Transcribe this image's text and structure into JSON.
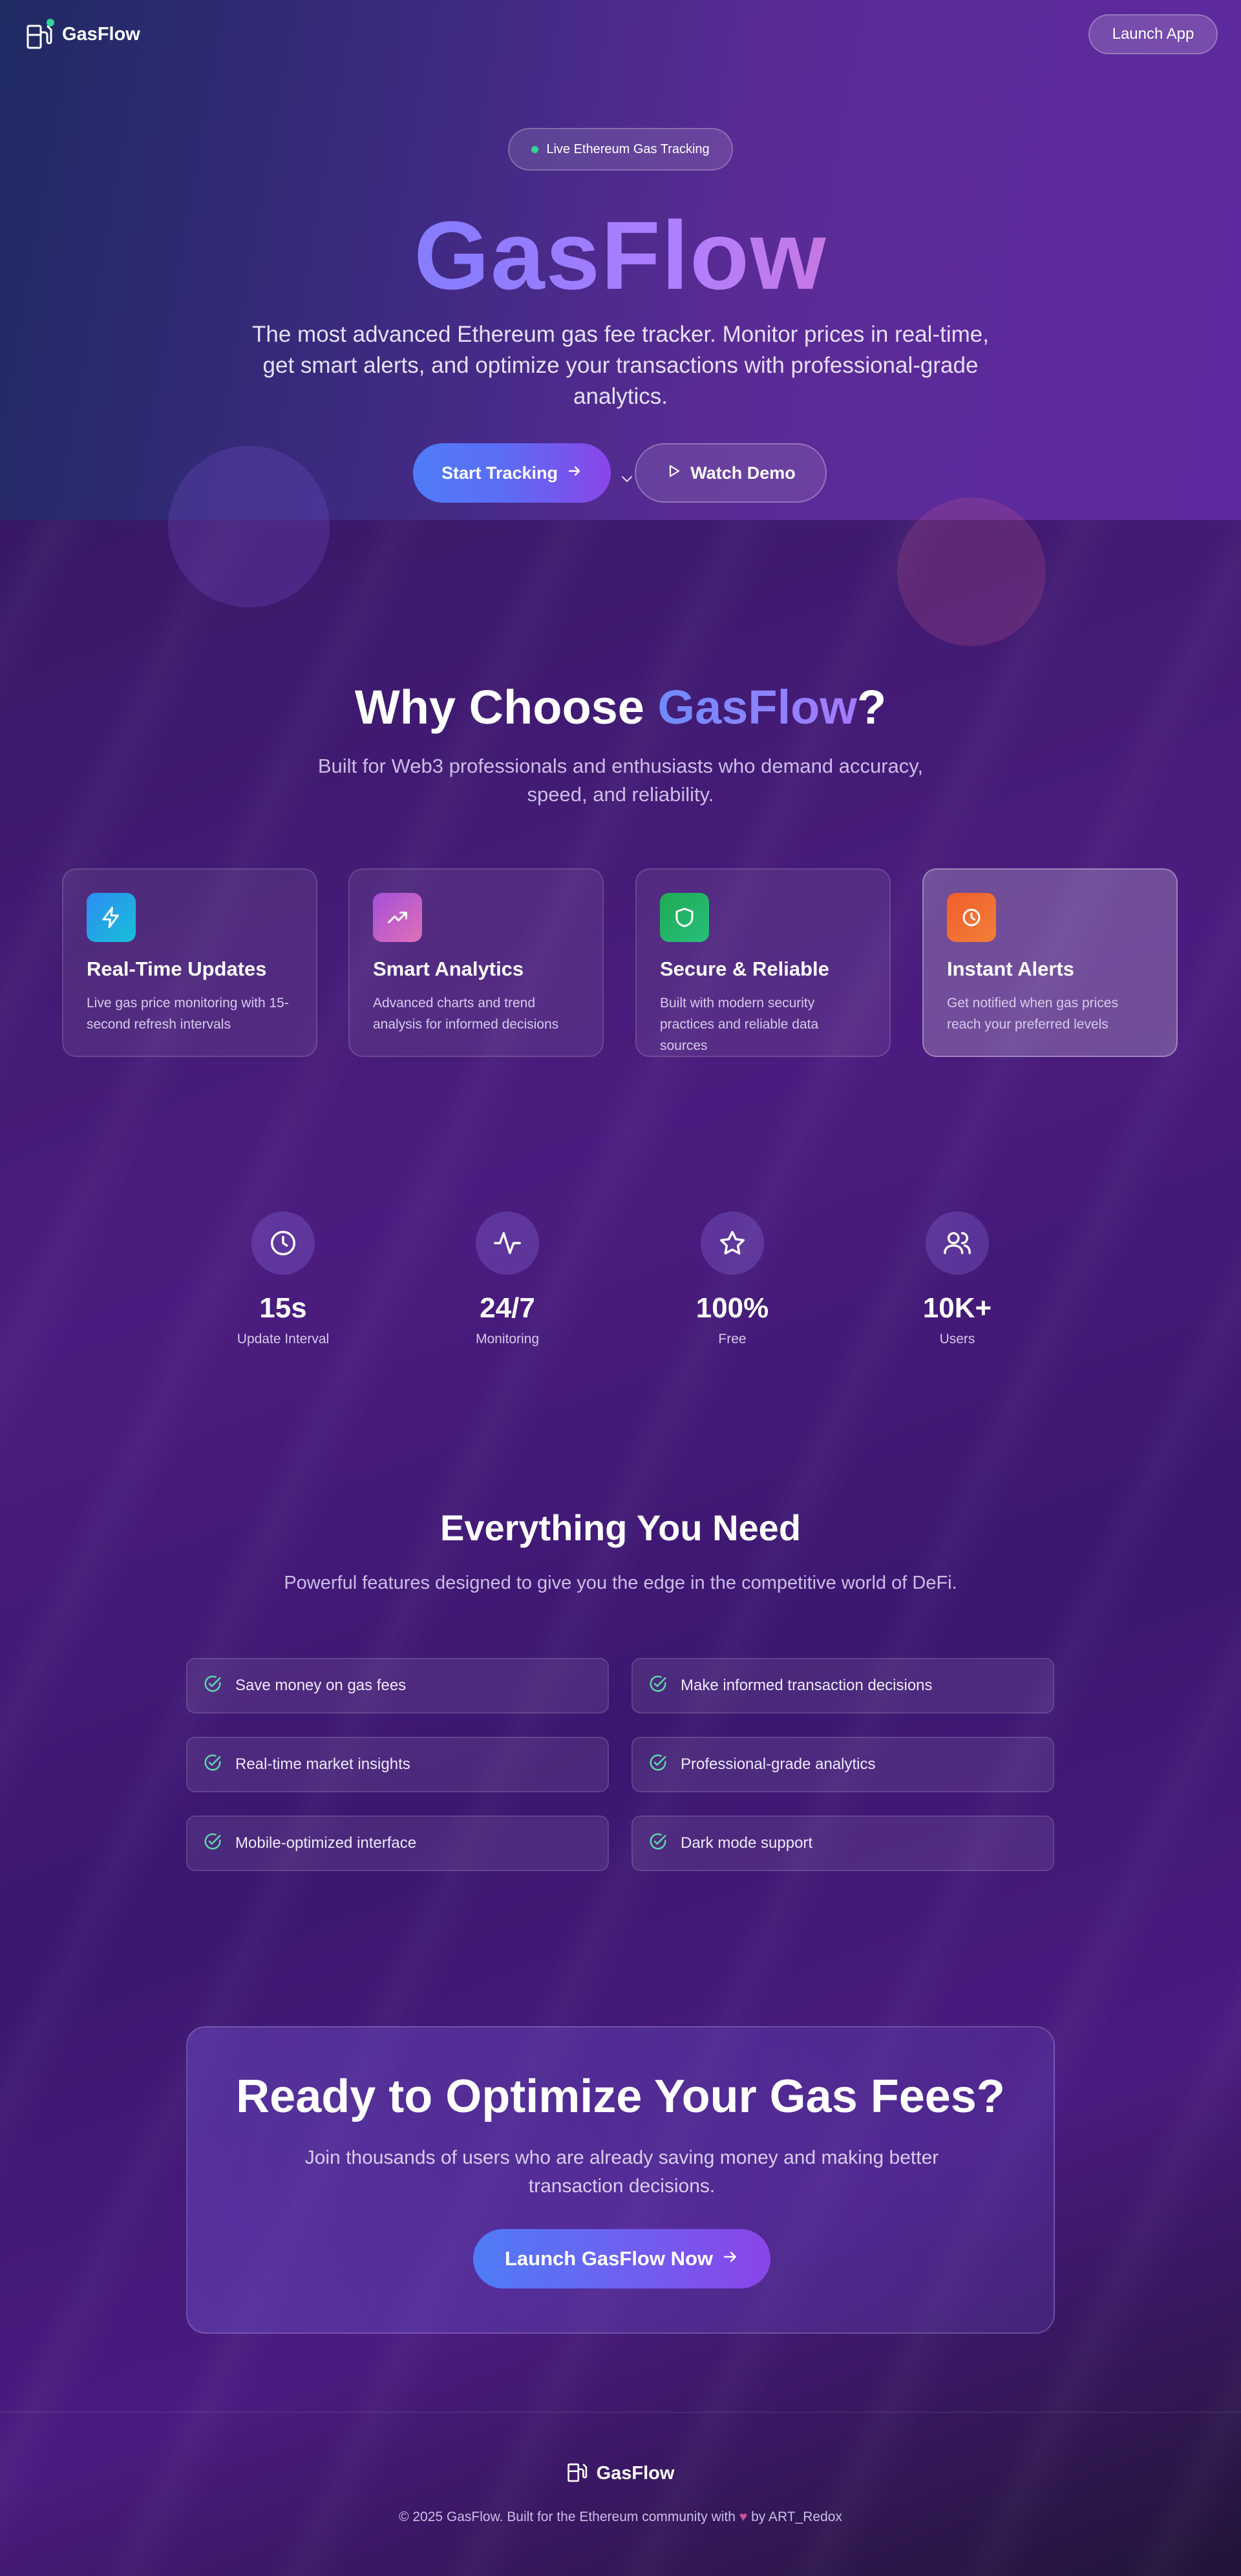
{
  "nav": {
    "brand": "GasFlow",
    "launch_label": "Launch App"
  },
  "hero": {
    "badge": "Live Ethereum Gas Tracking",
    "title": "GasFlow",
    "subtitle": "The most advanced Ethereum gas fee tracker. Monitor prices in real-time, get smart alerts, and optimize your transactions with professional-grade analytics.",
    "primary_label": "Start Tracking",
    "secondary_label": "Watch Demo"
  },
  "why": {
    "title_prefix": "Why Choose ",
    "title_highlight": "GasFlow",
    "title_suffix": "?",
    "subtitle": "Built for Web3 professionals and enthusiasts who demand accuracy, speed, and reliability.",
    "cards": [
      {
        "icon": "lightning-icon",
        "title": "Real-Time Updates",
        "desc": "Live gas price monitoring with 15-second refresh intervals",
        "color": "#1fa6e8"
      },
      {
        "icon": "trend-up-icon",
        "title": "Smart Analytics",
        "desc": "Advanced charts and trend analysis for informed decisions",
        "color": "#c85fd0"
      },
      {
        "icon": "shield-icon",
        "title": "Secure & Reliable",
        "desc": "Built with modern security practices and reliable data sources",
        "color": "#22b566"
      },
      {
        "icon": "alarm-clock-icon",
        "title": "Instant Alerts",
        "desc": "Get notified when gas prices reach your preferred levels",
        "color": "#f06a2c"
      }
    ]
  },
  "stats": [
    {
      "icon": "clock-icon",
      "value": "15s",
      "label": "Update Interval"
    },
    {
      "icon": "activity-icon",
      "value": "24/7",
      "label": "Monitoring"
    },
    {
      "icon": "star-icon",
      "value": "100%",
      "label": "Free"
    },
    {
      "icon": "users-icon",
      "value": "10K+",
      "label": "Users"
    }
  ],
  "needs": {
    "title": "Everything You Need",
    "subtitle": "Powerful features designed to give you the edge in the competitive world of DeFi.",
    "items": [
      "Save money on gas fees",
      "Make informed transaction decisions",
      "Real-time market insights",
      "Professional-grade analytics",
      "Mobile-optimized interface",
      "Dark mode support"
    ]
  },
  "cta": {
    "title": "Ready to Optimize Your Gas Fees?",
    "subtitle": "Join thousands of users who are already saving money and making better transaction decisions.",
    "button_label": "Launch GasFlow Now"
  },
  "footer": {
    "brand": "GasFlow",
    "copy_before": "© 2025 GasFlow. Built for the Ethereum community with",
    "copy_after": "by ART_Redox"
  },
  "colors": {
    "accent_green": "#34d399",
    "accent_blue": "#4f7cf7",
    "accent_purple": "#8a45e8"
  }
}
